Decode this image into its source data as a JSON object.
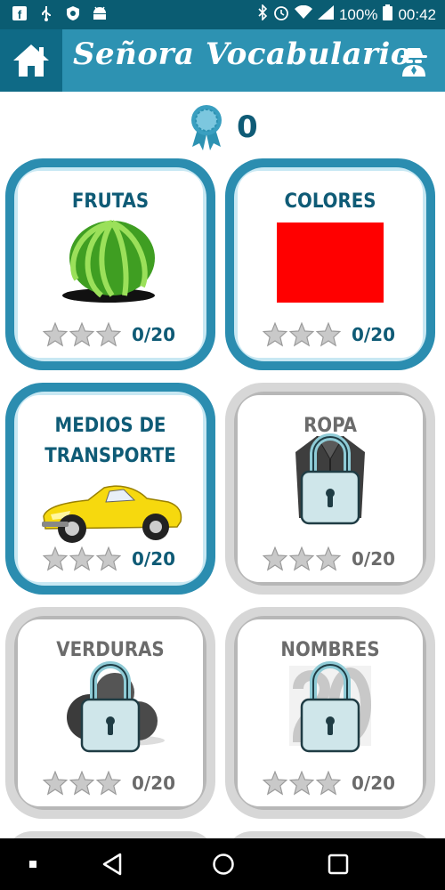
{
  "status_bar": {
    "battery": "100%",
    "time": "00:42"
  },
  "app_bar": {
    "title": "Señora Vocabulario"
  },
  "score": {
    "value": "0"
  },
  "categories": [
    {
      "title": "FRUTAS",
      "progress": "0/20",
      "stars": 0,
      "locked": false,
      "image": "watermelon"
    },
    {
      "title": "COLORES",
      "progress": "0/20",
      "stars": 0,
      "locked": false,
      "image": "red-square"
    },
    {
      "title": "MEDIOS DE TRANSPORTE",
      "progress": "0/20",
      "stars": 0,
      "locked": false,
      "image": "yellow-car"
    },
    {
      "title": "ROPA",
      "progress": "0/20",
      "stars": 0,
      "locked": true,
      "image": "jacket"
    },
    {
      "title": "VERDURAS",
      "progress": "0/20",
      "stars": 0,
      "locked": true,
      "image": "vegetables"
    },
    {
      "title": "NOMBRES",
      "progress": "0/20",
      "stars": 0,
      "locked": true,
      "image": "number-20"
    }
  ],
  "colors": {
    "primary": "#2d92b2",
    "dark": "#0f5b76",
    "locked_gray": "#b7b7b7",
    "colores_red": "#ff0000"
  }
}
